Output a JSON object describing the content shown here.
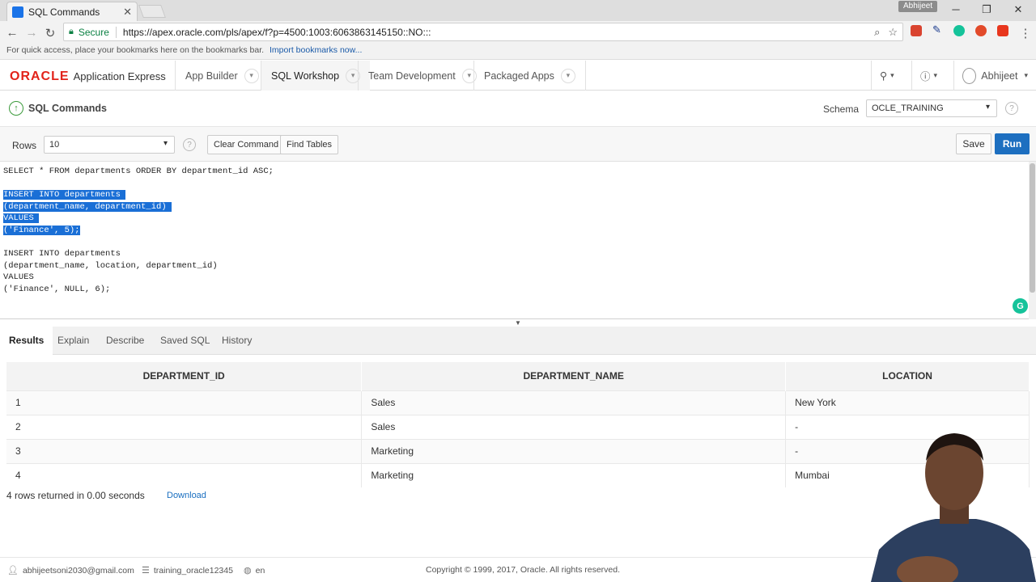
{
  "browser": {
    "tab_title": "SQL Commands",
    "profile_name": "Abhijeet",
    "secure_label": "Secure",
    "url": "https://apex.oracle.com/pls/apex/f?p=4500:1003:6063863145150::NO:::",
    "bookmarks_text": "For quick access, place your bookmarks here on the bookmarks bar.",
    "bookmarks_link": "Import bookmarks now..."
  },
  "apex_nav": {
    "brand": "ORACLE",
    "product": "Application Express",
    "tabs": [
      {
        "label": "App Builder"
      },
      {
        "label": "SQL Workshop"
      },
      {
        "label": "Team Development"
      },
      {
        "label": "Packaged Apps"
      }
    ],
    "user": "Abhijeet"
  },
  "page": {
    "title": "SQL Commands",
    "schema_label": "Schema",
    "schema_value": "OCLE_TRAINING"
  },
  "toolbar": {
    "rows_label": "Rows",
    "rows_value": "10",
    "clear_command": "Clear Command",
    "find_tables": "Find Tables",
    "save": "Save",
    "run": "Run"
  },
  "editor": {
    "lines": [
      {
        "text": "SELECT * FROM departments ORDER BY department_id ASC;",
        "selected": false
      },
      {
        "text": "",
        "selected": false
      },
      {
        "text": "INSERT INTO departments ",
        "selected": true
      },
      {
        "text": "(department_name, department_id) ",
        "selected": true
      },
      {
        "text": "VALUES ",
        "selected": true
      },
      {
        "text": "('Finance', 5);",
        "selected": true
      },
      {
        "text": "",
        "selected": false
      },
      {
        "text": "INSERT INTO departments",
        "selected": false
      },
      {
        "text": "(department_name, location, department_id)",
        "selected": false
      },
      {
        "text": "VALUES",
        "selected": false
      },
      {
        "text": "('Finance', NULL, 6);",
        "selected": false
      }
    ]
  },
  "results_tabs": [
    {
      "label": "Results",
      "active": true
    },
    {
      "label": "Explain",
      "active": false
    },
    {
      "label": "Describe",
      "active": false
    },
    {
      "label": "Saved SQL",
      "active": false
    },
    {
      "label": "History",
      "active": false
    }
  ],
  "results": {
    "columns": [
      "DEPARTMENT_ID",
      "DEPARTMENT_NAME",
      "LOCATION"
    ],
    "rows": [
      [
        "1",
        "Sales",
        "New York"
      ],
      [
        "2",
        "Sales",
        "-"
      ],
      [
        "3",
        "Marketing",
        "-"
      ],
      [
        "4",
        "Marketing",
        "Mumbai"
      ]
    ],
    "summary": "4 rows returned in 0.00 seconds",
    "download": "Download"
  },
  "footer": {
    "email": "abhijeetsoni2030@gmail.com",
    "workspace": "training_oracle12345",
    "language": "en",
    "copyright": "Copyright © 1999, 2017, Oracle. All rights reserved."
  },
  "colors": {
    "oracle_red": "#e2231a",
    "run_blue": "#1d6fc0",
    "selection_blue": "#1a6fd6",
    "secure_green": "#0b8043"
  }
}
